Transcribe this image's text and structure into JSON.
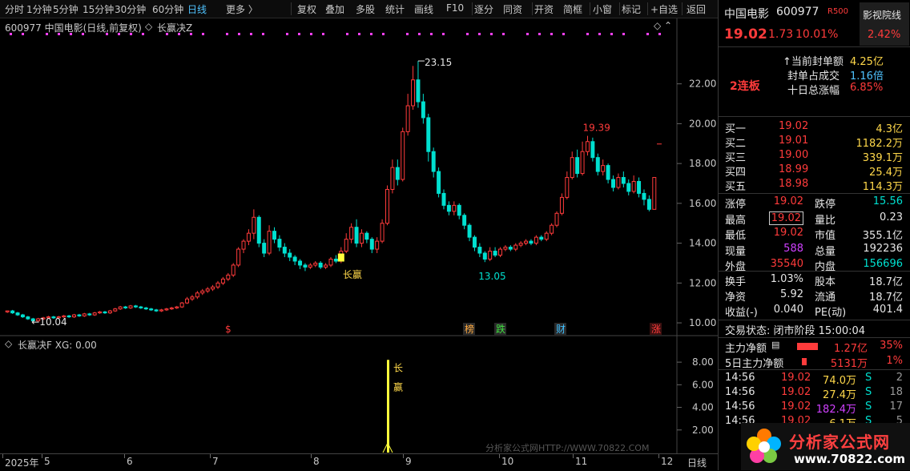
{
  "toolbar": {
    "items": [
      "分时",
      "1分钟",
      "5分钟",
      "15分钟",
      "30分钟",
      "60分钟",
      "日线",
      "更多 〉",
      "复权",
      "叠加",
      "多股",
      "统计",
      "画线",
      "F10",
      "逐分",
      "同资",
      "开资",
      "简框",
      "小窗",
      "标记",
      "+自选",
      "返回"
    ],
    "active": "日线"
  },
  "main": {
    "title": "600977 中国电影(日线,前复权)",
    "indicator": "长赢决Z",
    "high_label": "23.15",
    "low_label": "10.04",
    "peak2_label": "19.39",
    "trough_label": "13.05",
    "signal_label": "长赢",
    "markers": [
      "$",
      "榜",
      "跌",
      "财",
      "涨"
    ]
  },
  "sub": {
    "title": "长赢决F XG: 0.00",
    "signal_chars": [
      "长",
      "赢"
    ]
  },
  "watermark": "分析家公式网HTTP://WWW.70822.COM",
  "logo": {
    "name": "分析家公式网",
    "url": "www.70822.com"
  },
  "chart_data": [
    {
      "type": "candlestick",
      "title": "600977 中国电影(日线,前复权)",
      "ylim": [
        9.6,
        24.4
      ],
      "yticks": [
        "22.00",
        "20.00",
        "18.00",
        "16.00",
        "14.00",
        "12.00",
        "10.00"
      ],
      "xticks": [
        "2025年",
        "5",
        "6",
        "7",
        "8",
        "9",
        "10",
        "11",
        "12"
      ],
      "x_unit": "日线",
      "candles": [
        [
          10.55,
          10.6,
          10.5,
          10.62
        ],
        [
          10.6,
          10.5,
          10.45,
          10.65
        ],
        [
          10.5,
          10.4,
          10.35,
          10.55
        ],
        [
          10.4,
          10.3,
          10.25,
          10.45
        ],
        [
          10.3,
          10.2,
          10.15,
          10.35
        ],
        [
          10.2,
          10.1,
          10.04,
          10.25
        ],
        [
          10.1,
          10.2,
          10.05,
          10.25
        ],
        [
          10.2,
          10.25,
          10.15,
          10.3
        ],
        [
          10.25,
          10.3,
          10.2,
          10.35
        ],
        [
          10.3,
          10.25,
          10.2,
          10.35
        ],
        [
          10.25,
          10.3,
          10.2,
          10.35
        ],
        [
          10.3,
          10.35,
          10.25,
          10.4
        ],
        [
          10.35,
          10.3,
          10.25,
          10.4
        ],
        [
          10.3,
          10.4,
          10.25,
          10.45
        ],
        [
          10.4,
          10.35,
          10.3,
          10.45
        ],
        [
          10.35,
          10.45,
          10.3,
          10.5
        ],
        [
          10.45,
          10.4,
          10.35,
          10.5
        ],
        [
          10.4,
          10.5,
          10.35,
          10.55
        ],
        [
          10.5,
          10.55,
          10.45,
          10.6
        ],
        [
          10.55,
          10.5,
          10.45,
          10.6
        ],
        [
          10.5,
          10.6,
          10.45,
          10.65
        ],
        [
          10.6,
          10.7,
          10.55,
          10.75
        ],
        [
          10.7,
          10.8,
          10.65,
          10.85
        ],
        [
          10.8,
          10.75,
          10.7,
          10.85
        ],
        [
          10.75,
          10.85,
          10.7,
          10.9
        ],
        [
          10.85,
          10.8,
          10.75,
          10.9
        ],
        [
          10.8,
          10.75,
          10.7,
          10.85
        ],
        [
          10.75,
          10.7,
          10.65,
          10.8
        ],
        [
          10.7,
          10.65,
          10.6,
          10.75
        ],
        [
          10.65,
          10.6,
          10.55,
          10.7
        ],
        [
          10.6,
          10.65,
          10.55,
          10.7
        ],
        [
          10.65,
          10.7,
          10.6,
          10.75
        ],
        [
          10.7,
          10.75,
          10.65,
          10.8
        ],
        [
          10.75,
          10.8,
          10.7,
          10.85
        ],
        [
          10.8,
          11.0,
          10.75,
          11.05
        ],
        [
          11.0,
          11.2,
          10.95,
          11.3
        ],
        [
          11.2,
          11.3,
          11.1,
          11.4
        ],
        [
          11.3,
          11.5,
          11.2,
          11.6
        ],
        [
          11.5,
          11.6,
          11.4,
          11.7
        ],
        [
          11.6,
          11.7,
          11.5,
          11.8
        ],
        [
          11.7,
          11.8,
          11.6,
          11.9
        ],
        [
          11.8,
          12.0,
          11.7,
          12.1
        ],
        [
          12.0,
          12.2,
          11.9,
          12.3
        ],
        [
          12.2,
          12.4,
          12.1,
          12.5
        ],
        [
          12.4,
          12.9,
          12.3,
          13.0
        ],
        [
          12.9,
          13.7,
          12.8,
          13.8
        ],
        [
          13.7,
          14.1,
          13.5,
          14.2
        ],
        [
          14.1,
          14.5,
          13.9,
          14.7
        ],
        [
          14.5,
          15.3,
          14.2,
          15.7
        ],
        [
          15.3,
          14.0,
          13.8,
          15.4
        ],
        [
          14.0,
          13.5,
          13.3,
          14.2
        ],
        [
          13.5,
          14.6,
          13.4,
          14.9
        ],
        [
          14.6,
          14.2,
          14.0,
          14.8
        ],
        [
          14.2,
          13.8,
          13.6,
          14.4
        ],
        [
          13.8,
          13.5,
          13.3,
          14.0
        ],
        [
          13.5,
          13.3,
          13.1,
          13.7
        ],
        [
          13.3,
          13.1,
          12.9,
          13.4
        ],
        [
          13.1,
          12.9,
          12.7,
          13.2
        ],
        [
          12.9,
          12.8,
          12.6,
          13.0
        ],
        [
          12.8,
          12.9,
          12.7,
          13.0
        ],
        [
          12.9,
          13.0,
          12.8,
          13.1
        ],
        [
          13.0,
          12.8,
          12.7,
          13.1
        ],
        [
          12.8,
          12.9,
          12.7,
          13.0
        ],
        [
          12.9,
          13.2,
          12.8,
          13.3
        ],
        [
          13.2,
          13.1,
          13.0,
          13.4
        ],
        [
          13.1,
          13.6,
          13.0,
          13.8
        ],
        [
          13.6,
          14.2,
          13.5,
          14.5
        ],
        [
          14.2,
          14.8,
          14.0,
          15.0
        ],
        [
          14.8,
          14.0,
          13.8,
          15.2
        ],
        [
          14.0,
          14.5,
          13.8,
          14.7
        ],
        [
          14.5,
          14.2,
          14.0,
          14.6
        ],
        [
          14.2,
          13.7,
          13.5,
          14.3
        ],
        [
          13.7,
          14.1,
          13.5,
          14.3
        ],
        [
          14.1,
          15.0,
          14.0,
          15.2
        ],
        [
          15.0,
          16.7,
          14.9,
          16.9
        ],
        [
          16.7,
          17.8,
          16.5,
          18.2
        ],
        [
          17.8,
          17.2,
          16.9,
          18.2
        ],
        [
          17.2,
          19.6,
          17.1,
          19.8
        ],
        [
          19.6,
          20.9,
          19.4,
          21.5
        ],
        [
          20.9,
          22.2,
          20.7,
          22.9
        ],
        [
          22.2,
          21.1,
          20.8,
          23.15
        ],
        [
          21.1,
          20.3,
          20.0,
          21.5
        ],
        [
          20.3,
          18.6,
          18.1,
          20.5
        ],
        [
          18.6,
          17.6,
          17.3,
          18.8
        ],
        [
          17.6,
          16.5,
          16.3,
          17.8
        ],
        [
          16.5,
          15.9,
          15.7,
          16.7
        ],
        [
          15.9,
          15.6,
          15.4,
          16.1
        ],
        [
          15.6,
          15.9,
          15.4,
          16.1
        ],
        [
          15.9,
          15.4,
          15.2,
          16.0
        ],
        [
          15.4,
          14.9,
          14.7,
          15.5
        ],
        [
          14.9,
          14.3,
          14.1,
          15.0
        ],
        [
          14.3,
          13.8,
          13.6,
          14.4
        ],
        [
          13.8,
          13.5,
          13.3,
          14.0
        ],
        [
          13.5,
          13.2,
          13.05,
          13.6
        ],
        [
          13.2,
          13.6,
          13.1,
          13.8
        ],
        [
          13.6,
          13.4,
          13.3,
          13.8
        ],
        [
          13.4,
          13.7,
          13.3,
          13.8
        ],
        [
          13.7,
          13.8,
          13.6,
          13.9
        ],
        [
          13.8,
          13.7,
          13.6,
          13.9
        ],
        [
          13.7,
          13.9,
          13.6,
          14.0
        ],
        [
          13.9,
          14.0,
          13.8,
          14.1
        ],
        [
          14.0,
          14.1,
          13.9,
          14.2
        ],
        [
          14.1,
          14.0,
          13.9,
          14.2
        ],
        [
          14.0,
          14.3,
          13.9,
          14.4
        ],
        [
          14.3,
          14.2,
          14.1,
          14.4
        ],
        [
          14.2,
          14.5,
          14.1,
          14.6
        ],
        [
          14.5,
          14.9,
          14.4,
          15.0
        ],
        [
          14.9,
          15.5,
          14.8,
          15.6
        ],
        [
          15.5,
          16.3,
          15.4,
          16.5
        ],
        [
          16.3,
          17.3,
          16.2,
          17.6
        ],
        [
          17.3,
          18.3,
          17.2,
          18.6
        ],
        [
          18.3,
          17.5,
          17.3,
          18.7
        ],
        [
          17.5,
          18.6,
          17.4,
          19.1
        ],
        [
          18.6,
          19.1,
          18.4,
          19.39
        ],
        [
          19.1,
          18.3,
          18.1,
          19.3
        ],
        [
          18.3,
          17.6,
          17.4,
          18.5
        ],
        [
          17.6,
          17.9,
          17.4,
          18.2
        ],
        [
          17.9,
          17.2,
          17.0,
          18.0
        ],
        [
          17.2,
          16.8,
          16.6,
          17.4
        ],
        [
          16.8,
          17.3,
          16.7,
          17.5
        ],
        [
          17.3,
          17.0,
          16.8,
          17.6
        ],
        [
          17.0,
          16.6,
          16.4,
          17.2
        ],
        [
          16.6,
          17.1,
          16.5,
          17.4
        ],
        [
          17.1,
          16.5,
          16.3,
          17.3
        ],
        [
          16.5,
          16.2,
          15.9,
          16.7
        ],
        [
          16.2,
          15.7,
          15.6,
          16.4
        ],
        [
          15.7,
          17.3,
          15.7,
          17.3
        ]
      ]
    },
    {
      "type": "bar",
      "title": "长赢决F",
      "series": [
        {
          "name": "XG",
          "values": [
            0,
            8.2,
            0
          ]
        }
      ],
      "yticks": [
        "8.00",
        "6.00",
        "4.00",
        "2.00"
      ],
      "ylim": [
        0,
        9
      ]
    }
  ],
  "right": {
    "name": "中国电影",
    "code": "600977",
    "tag": "R500",
    "sector": "影视院线",
    "sector_pct": "2.42%",
    "price": "19.02",
    "change": "1.73",
    "pct": "10.01%",
    "lb_badge": "2连板",
    "seal_rows": [
      {
        "k": "↑当前封单额",
        "v": "4.25亿"
      },
      {
        "k": "封单占成交",
        "v": "1.16倍"
      },
      {
        "k": "十日总涨幅",
        "v": "6.85%"
      }
    ],
    "buys": [
      {
        "k": "买一",
        "p": "19.02",
        "v": "4.3亿"
      },
      {
        "k": "买二",
        "p": "19.01",
        "v": "1182.2万"
      },
      {
        "k": "买三",
        "p": "19.00",
        "v": "339.1万"
      },
      {
        "k": "买四",
        "p": "18.99",
        "v": "25.4万"
      },
      {
        "k": "买五",
        "p": "18.98",
        "v": "114.3万"
      }
    ],
    "stats": [
      [
        "涨停",
        "19.02",
        "跌停",
        "15.56"
      ],
      [
        "最高",
        "19.02",
        "量比",
        "0.23"
      ],
      [
        "最低",
        "19.02",
        "市值",
        "355.1亿"
      ],
      [
        "现量",
        "588",
        "总量",
        "192236"
      ],
      [
        "外盘",
        "35540",
        "内盘",
        "156696"
      ]
    ],
    "stats2": [
      [
        "换手",
        "1.03%",
        "股本",
        "18.7亿"
      ],
      [
        "净资",
        "5.92",
        "流通",
        "18.7亿"
      ],
      [
        "收益(-)",
        "0.040",
        "PE(动)",
        "401.4"
      ]
    ],
    "status": "交易状态: 闭市阶段 15:00:04",
    "flows": [
      {
        "k": "主力净额",
        "v": "1.27亿",
        "p": "35%"
      },
      {
        "k": "5日主力净额",
        "v": "5131万",
        "p": "1%"
      }
    ],
    "ticks": [
      {
        "t": "14:56",
        "p": "19.02",
        "v": "74.0万",
        "s": "S",
        "n": "2"
      },
      {
        "t": "14:56",
        "p": "19.02",
        "v": "27.4万",
        "s": "S",
        "n": "18"
      },
      {
        "t": "14:56",
        "p": "19.02",
        "v": "182.4万",
        "s": "S",
        "n": "17"
      },
      {
        "t": "14:56",
        "p": "19.02",
        "v": "6.1万",
        "s": "S",
        "n": "5"
      }
    ]
  },
  "colors": {
    "up": "#ff3b3b",
    "down": "#00e0d0",
    "signal": "#ffff3c",
    "grid": "#3a1515"
  }
}
